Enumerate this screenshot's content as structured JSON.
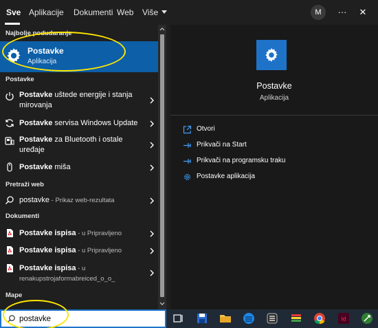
{
  "tabs": [
    {
      "label": "Sve",
      "active": true
    },
    {
      "label": "Aplikacije"
    },
    {
      "label": "Dokumenti"
    },
    {
      "label": "Web"
    },
    {
      "label": "Više"
    }
  ],
  "user": {
    "initial": "M"
  },
  "top_icons": {
    "more": "more-icon",
    "close": "close-icon"
  },
  "sections": {
    "best_match": "Najbolje podudaranje",
    "settings": "Postavke",
    "web": "Pretraži web",
    "documents": "Dokumenti",
    "folders": "Mape"
  },
  "best_match": {
    "title": "Postavke",
    "subtitle": "Aplikacija",
    "icon": "gear-icon"
  },
  "settings_items": [
    {
      "bold": "Postavke",
      "rest": " uštede energije i stanja mirovanja",
      "icon": "power-icon"
    },
    {
      "bold": "Postavke",
      "rest": " servisa Windows Update",
      "icon": "sync-icon"
    },
    {
      "bold": "Postavke",
      "rest": " za Bluetooth i ostale uređaje",
      "icon": "devices-icon"
    },
    {
      "bold": "Postavke",
      "rest": " miša",
      "icon": "mouse-icon"
    }
  ],
  "web_item": {
    "bold": "postavke",
    "rest": " - Prikaz web-rezultata",
    "icon": "search-icon"
  },
  "document_items": [
    {
      "bold": "Postavke",
      "rest": " ispisa",
      "dim": " - u Pripravljeno",
      "icon": "pdf-icon"
    },
    {
      "bold": "Postavke",
      "rest": " ispisa",
      "dim": " - u Pripravljeno",
      "icon": "pdf-icon"
    },
    {
      "bold": "Postavke",
      "rest": " ispisa",
      "dim": " - u",
      "dim2": "renakupstrojaformabreiced_o_o_",
      "icon": "pdf-icon"
    }
  ],
  "preview": {
    "title": "Postavke",
    "subtitle": "Aplikacija"
  },
  "actions": [
    {
      "label": "Otvori",
      "icon": "open-icon"
    },
    {
      "label": "Prikvači na Start",
      "icon": "pin-icon"
    },
    {
      "label": "Prikvači na programsku traku",
      "icon": "pin-icon"
    },
    {
      "label": "Postavke aplikacija",
      "icon": "gear-icon"
    }
  ],
  "search": {
    "value": "postavke"
  },
  "taskbar": [
    "task-view-icon",
    "save-icon",
    "file-explorer-icon",
    "app-icon",
    "notes-icon",
    "stack-app-icon",
    "chrome-icon",
    "indesign-icon",
    "tool-icon"
  ],
  "colors": {
    "accent": "#0d5fa8",
    "tile": "#1e73c8",
    "annotation": "#ffe600"
  }
}
